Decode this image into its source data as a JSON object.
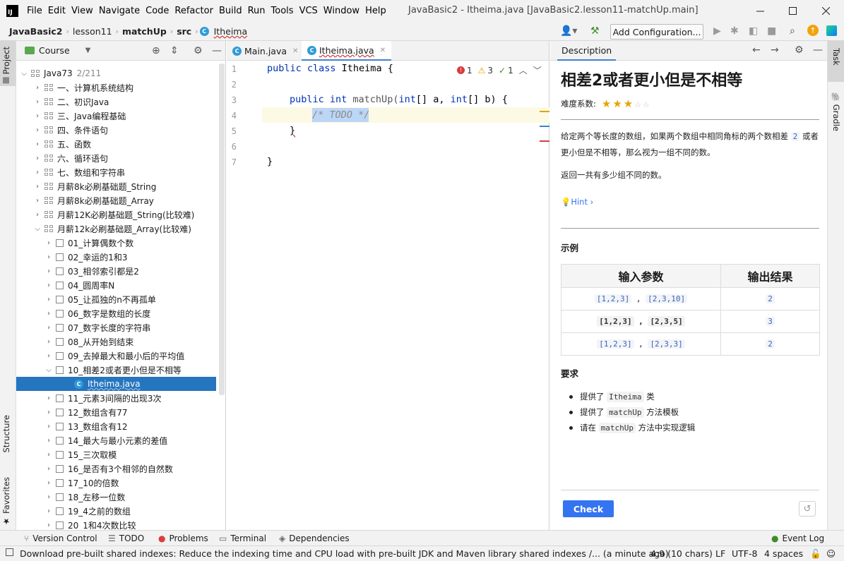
{
  "menubar": {
    "logo": "IJ",
    "items": [
      "File",
      "Edit",
      "View",
      "Navigate",
      "Code",
      "Refactor",
      "Build",
      "Run",
      "Tools",
      "VCS",
      "Window",
      "Help"
    ],
    "title": "JavaBasic2 - Itheima.java [JavaBasic2.lesson11-matchUp.main]"
  },
  "navbar": {
    "crumbs": [
      "JavaBasic2",
      "lesson11",
      "matchUp",
      "src",
      "Itheima"
    ],
    "add_configuration": "Add Configuration..."
  },
  "left_stripe": {
    "project": "Project",
    "structure": "Structure",
    "favorites": "Favorites"
  },
  "right_stripe": {
    "task": "Task",
    "gradle": "Gradle"
  },
  "project": {
    "header": "Course",
    "root": {
      "name": "Java73",
      "progress": "2/211"
    },
    "sections": [
      "一、计算机系统结构",
      "二、初识Java",
      "三、Java编程基础",
      "四、条件语句",
      "五、函数",
      "六、循环语句",
      "七、数组和字符串",
      "月薪8k必刷基础题_String",
      "月薪8k必刷基础题_Array",
      "月薪12K必刷基础题_String(比较难)",
      "月薪12k必刷基础题_Array(比较难)"
    ],
    "lessons": [
      "01_计算偶数个数",
      "02_幸运的1和3",
      "03_相邻索引都是2",
      "04_圆周率N",
      "05_让孤独的n不再孤单",
      "06_数字是数组的长度",
      "07_数字长度的字符串",
      "08_从开始到结束",
      "09_去掉最大和最小后的平均值",
      "10_相差2或者更小但是不相等"
    ],
    "selected_file": "Itheima.java",
    "lessons_after": [
      "11_元素3间隔的出现3次",
      "12_数组含有77",
      "13_数组含有12",
      "14_最大与最小元素的差值",
      "15_三次取模",
      "16_是否有3个相邻的自然数",
      "17_10的倍数",
      "18_左移一位数",
      "19_4之前的数组",
      "20_1和4次数比较"
    ]
  },
  "editor": {
    "tabs": [
      {
        "label": "Main.java",
        "active": false
      },
      {
        "label": "Itheima.java",
        "active": true
      }
    ],
    "inspections": {
      "errors": "1",
      "warnings": "3",
      "ok": "1"
    },
    "line_numbers": [
      "1",
      "2",
      "3",
      "4",
      "5",
      "6",
      "7"
    ],
    "lines": {
      "l1_kw": "public class ",
      "l1_name": "Itheima {",
      "l3_kw1": "public ",
      "l3_kw2": "int ",
      "l3_mid": "matchUp(",
      "l3_kw3": "int",
      "l3_a": "[] a, ",
      "l3_kw4": "int",
      "l3_b": "[] b) {",
      "l4": "/* TODO */",
      "l5": "}",
      "l7": "}"
    }
  },
  "description": {
    "tab": "Description",
    "title": "相差2或者更小但是不相等",
    "difficulty_label": "难度系数:",
    "difficulty_stars": 3,
    "difficulty_max": 5,
    "para1_a": "给定两个等长度的数组，如果两个数组中相同角标的两个数相差",
    "para1_code": "2",
    "para1_b": "或者更小但是不相等，那么视为一组不同的数。",
    "para2": "返回一共有多少组不同的数。",
    "hint": "Hint",
    "examples_title": "示例",
    "table_headers": [
      "输入参数",
      "输出结果"
    ],
    "rows": [
      {
        "in1": "[1,2,3]",
        "in2": "[2,3,10]",
        "out": "2"
      },
      {
        "in1": "[1,2,3]",
        "in2": "[2,3,5]",
        "out": "3"
      },
      {
        "in1": "[1,2,3]",
        "in2": "[2,3,3]",
        "out": "2"
      }
    ],
    "requirements_title": "要求",
    "requirements": [
      {
        "pre": "提供了",
        "code": "Itheima",
        "post": "类"
      },
      {
        "pre": "提供了",
        "code": "matchUp",
        "post": "方法模板"
      },
      {
        "pre": "请在",
        "code": "matchUp",
        "post": "方法中实现逻辑"
      }
    ],
    "check_label": "Check"
  },
  "bottom_tools": [
    "Version Control",
    "TODO",
    "Problems",
    "Terminal",
    "Dependencies",
    "Event Log"
  ],
  "status": {
    "message": "Download pre-built shared indexes: Reduce the indexing time and CPU load with pre-built JDK and Maven library shared indexes /... (a minute ago)",
    "position": "4:9 (10 chars)",
    "line_sep": "LF",
    "encoding": "UTF-8",
    "indent": "4 spaces"
  },
  "colors": {
    "accent": "#3574f0",
    "selection": "#2675bf",
    "keyword": "#0033b3",
    "star": "#e5a500"
  }
}
